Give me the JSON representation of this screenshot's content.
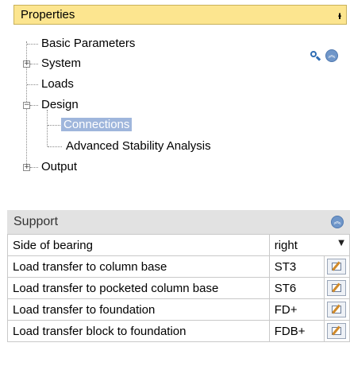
{
  "properties": {
    "title": "Properties",
    "pin_icon": "pin-icon"
  },
  "tree": {
    "items": [
      {
        "label": "Basic Parameters"
      },
      {
        "label": "System"
      },
      {
        "label": "Loads"
      },
      {
        "label": "Design"
      },
      {
        "label": "Connections"
      },
      {
        "label": "Advanced Stability Analysis"
      },
      {
        "label": "Output"
      }
    ],
    "expander_plus": "+",
    "expander_minus": "−",
    "selected_label": "Connections"
  },
  "toolbar": {
    "search_icon": "search-icon",
    "collapse_icon": "collapse-up-icon",
    "collapse_glyph": "︽"
  },
  "support": {
    "title": "Support",
    "collapse_glyph": "︽",
    "rows": [
      {
        "name": "Side of bearing",
        "value": "right",
        "control": "dropdown"
      },
      {
        "name": "Load transfer to column base",
        "value": "ST3",
        "control": "edit"
      },
      {
        "name": "Load transfer to pocketed column base",
        "value": "ST6",
        "control": "edit"
      },
      {
        "name": "Load transfer to foundation",
        "value": "FD+",
        "control": "edit"
      },
      {
        "name": "Load transfer block to foundation",
        "value": "FDB+",
        "control": "edit"
      }
    ],
    "dropdown_glyph": "▼"
  }
}
